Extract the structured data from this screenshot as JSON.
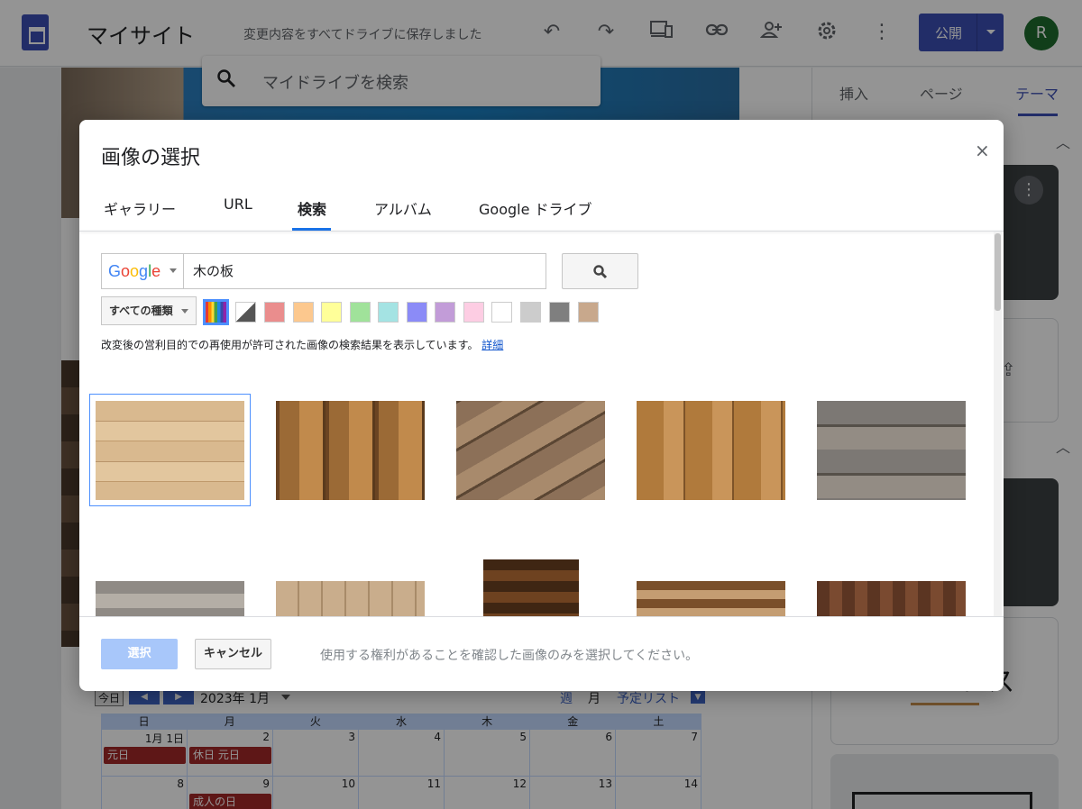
{
  "app": {
    "title": "マイサイト",
    "save_status": "変更内容をすべてドライブに保存しました",
    "publish_label": "公開",
    "avatar_initial": "R"
  },
  "drive_search": {
    "placeholder": "マイドライブを検索"
  },
  "side_panel": {
    "tabs": [
      {
        "label": "挿入"
      },
      {
        "label": "ページ"
      },
      {
        "label": "テーマ",
        "active": true
      }
    ],
    "card_partial_text": "ンス"
  },
  "calendar": {
    "today_label": "今日",
    "month": "2023年 1月",
    "views": [
      {
        "label": "週"
      },
      {
        "label": "月",
        "selected": true
      },
      {
        "label": "予定リスト"
      }
    ],
    "weekdays": [
      "日",
      "月",
      "火",
      "水",
      "木",
      "金",
      "土"
    ],
    "weeks": [
      [
        "1月 1日",
        "2",
        "3",
        "4",
        "5",
        "6",
        "7"
      ],
      [
        "8",
        "9",
        "10",
        "11",
        "12",
        "13",
        "14"
      ]
    ],
    "events": [
      {
        "text": "元日"
      },
      {
        "text": "休日 元日"
      },
      {
        "text": "成人の日"
      }
    ]
  },
  "dialog": {
    "title": "画像の選択",
    "close_glyph": "×",
    "tabs": [
      {
        "label": "ギャラリー"
      },
      {
        "label": "URL"
      },
      {
        "label": "検索",
        "active": true
      },
      {
        "label": "アルバム"
      },
      {
        "label": "Google ドライブ"
      }
    ],
    "search": {
      "engine_logo": "Google",
      "query": "木の板"
    },
    "type_filter": "すべての種類",
    "colors": [
      "multicolor",
      "grayscale",
      "#ea8d8d",
      "#fcc88e",
      "#ffff99",
      "#a0e29a",
      "#a4e3e3",
      "#8b8bf7",
      "#c29cd8",
      "#fdcde3",
      "#ffffff",
      "#cccccc",
      "#7f7f7f",
      "#c8a88c"
    ],
    "license_text": "改変後の営利目的での再使用が許可された画像の検索結果を表示しています。",
    "license_link": "詳細",
    "results": [
      {
        "name": "light-horizontal-planks",
        "selected": true
      },
      {
        "name": "vertical-brown-planks"
      },
      {
        "name": "diagonal-weathered-boards"
      },
      {
        "name": "vertical-knotty-pine"
      },
      {
        "name": "gray-weathered-horizontal"
      },
      {
        "name": "gray-horizontal-planks"
      },
      {
        "name": "light-vertical-planks"
      },
      {
        "name": "dark-horizontal-planks"
      },
      {
        "name": "rustic-horizontal-boards"
      },
      {
        "name": "dark-vertical-boards"
      }
    ],
    "select_button": "選択",
    "cancel_button": "キャンセル",
    "footer_note": "使用する権利があることを確認した画像のみを選択してください。"
  }
}
